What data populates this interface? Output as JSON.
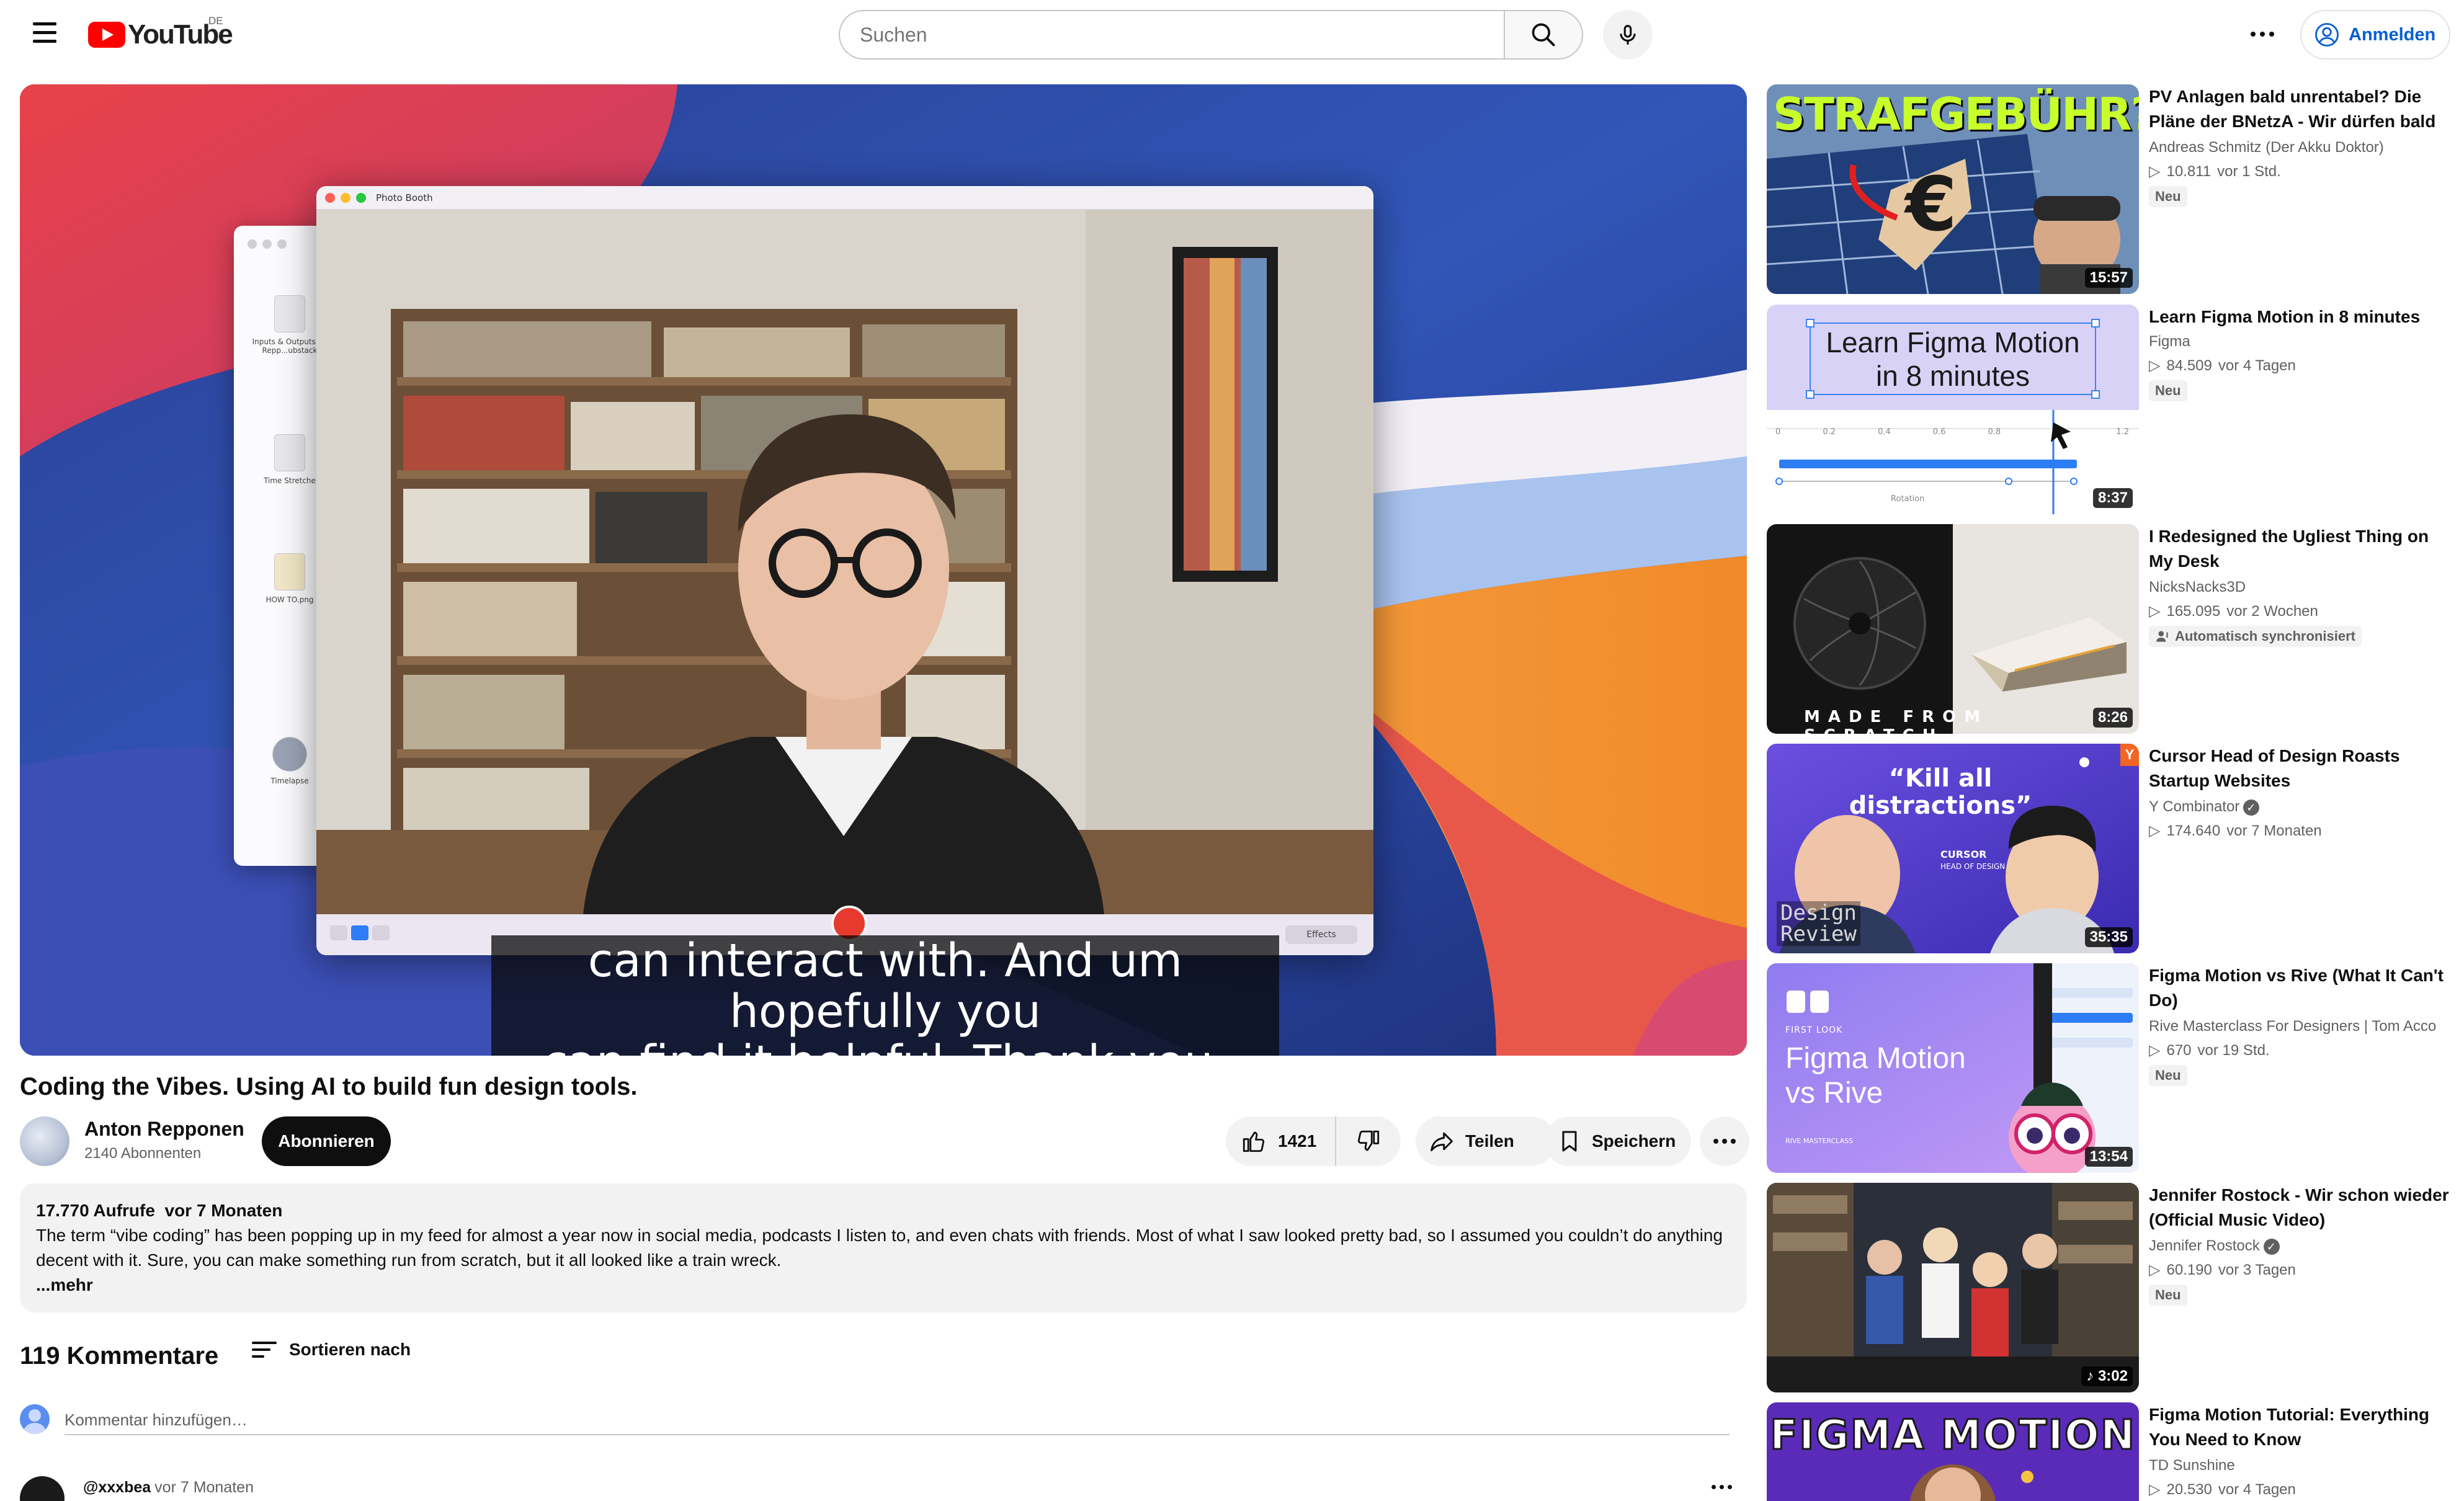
{
  "header": {
    "logo_text": "YouTube",
    "country_code": "DE",
    "search_placeholder": "Suchen",
    "sign_in_label": "Anmelden"
  },
  "player": {
    "photo_booth_title": "Photo Booth",
    "photo_booth_effects": "Effects",
    "finder_items": [
      "Inputs & Outputs by Repp...ubstack",
      "Time Stretche",
      "HOW TO.png",
      "Timelapse"
    ],
    "caption_lines": [
      "can interact with. And um hopefully you",
      "can find it helpful. Thank you. [Music]"
    ]
  },
  "video": {
    "title": "Coding the Vibes. Using AI to build fun design tools.",
    "channel_name": "Anton Repponen",
    "subscribers": "2140 Abonnenten",
    "subscribe_label": "Abonnieren",
    "likes": "1421",
    "share_label": "Teilen",
    "save_label": "Speichern"
  },
  "description": {
    "views": "17.770 Aufrufe",
    "age": "vor 7 Monaten",
    "text": "The term “vibe coding” has been popping up in my feed for almost a year now in social media, podcasts I listen to, and even chats with friends. Most of what I saw looked pretty bad, so I assumed you couldn’t do anything decent with it. Sure, you can make something run from scratch, but it all looked like a train wreck.",
    "more_label": "...mehr"
  },
  "comments": {
    "count_label": "119 Kommentare",
    "sort_label": "Sortieren nach",
    "input_placeholder": "Kommentar hinzufügen…",
    "first": {
      "author": "@xxxbea",
      "time": "vor 7 Monaten"
    }
  },
  "recommendations": [
    {
      "title": "PV Anlagen bald unrentabel? Die Pläne der BNetzA - Wir dürfen bald …",
      "channel": "Andreas Schmitz (Der Akku Doktor)",
      "views": "10.811",
      "time": "vor 1 Std.",
      "badge": "Neu",
      "duration": "15:57",
      "thumb_text": "STRAFGEBÜHR?"
    },
    {
      "title": "Learn Figma Motion in 8 minutes",
      "channel": "Figma",
      "views": "84.509",
      "time": "vor 4 Tagen",
      "badge": "Neu",
      "duration": "8:37",
      "thumb_text_1": "Learn Figma Motion",
      "thumb_text_2": "in 8 minutes",
      "thumb_ticks": [
        "0",
        "0.2",
        "0.4",
        "0.6",
        "0.8",
        "1.2"
      ],
      "thumb_label": "Rotation"
    },
    {
      "title": "I Redesigned the Ugliest Thing on My Desk",
      "channel": "NicksNacks3D",
      "views": "165.095",
      "time": "vor 2 Wochen",
      "badge": "Automatisch synchronisiert",
      "duration": "8:26",
      "thumb_text": "MADE FROM SCRATCH"
    },
    {
      "title": "Cursor Head of Design Roasts Startup Websites",
      "channel": "Y Combinator",
      "views": "174.640",
      "time": "vor 7 Monaten",
      "badge": "",
      "duration": "35:35",
      "thumb_text_1": "“Kill all",
      "thumb_text_2": "distractions”",
      "thumb_text_3": "CURSOR",
      "thumb_text_4": "HEAD OF DESIGN",
      "thumb_text_5": "Design",
      "thumb_text_6": "Review",
      "thumb_corner": "Y"
    },
    {
      "title": "Figma Motion vs Rive (What It Can't Do)",
      "channel": "Rive Masterclass For Designers | Tom Acco",
      "views": "670",
      "time": "vor 19 Std.",
      "badge": "Neu",
      "duration": "13:54",
      "thumb_text_1": "Figma Motion",
      "thumb_text_2": "vs Rive",
      "thumb_text_3": "FIRST LOOK",
      "thumb_text_4": "RIVE MASTERCLASS"
    },
    {
      "title": "Jennifer Rostock - Wir schon wieder (Official Music Video)",
      "channel": "Jennifer Rostock",
      "views": "60.190",
      "time": "vor 3 Tagen",
      "badge": "Neu",
      "duration": "3:02"
    },
    {
      "title": "Figma Motion Tutorial: Everything You Need to Know",
      "channel": "TD Sunshine",
      "views": "20.530",
      "time": "vor 4 Tagen",
      "badge": "",
      "duration": "",
      "thumb_text": "FIGMA MOTION"
    }
  ]
}
